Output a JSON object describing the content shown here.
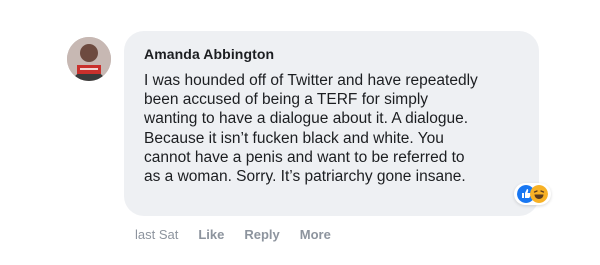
{
  "comment": {
    "author": "Amanda Abbington",
    "text": "I was hounded off of Twitter and have repeatedly been accused of being a TERF for simply wanting to have a dialogue about it. A dialogue. Because it isn’t fucken black and white. You cannot have a penis and want to be referred to as a woman. Sorry. It’s patriarchy gone insane.",
    "reactions": [
      "like-icon",
      "laugh-icon"
    ]
  },
  "actions": {
    "timestamp": "last Sat",
    "like_label": "Like",
    "reply_label": "Reply",
    "more_label": "More"
  },
  "colors": {
    "bubble_background": "#eef0f3",
    "text": "#1c1e21",
    "meta_text": "#8d949e",
    "like_blue": "#1877f2",
    "laugh_yellow": "#f7b125"
  }
}
